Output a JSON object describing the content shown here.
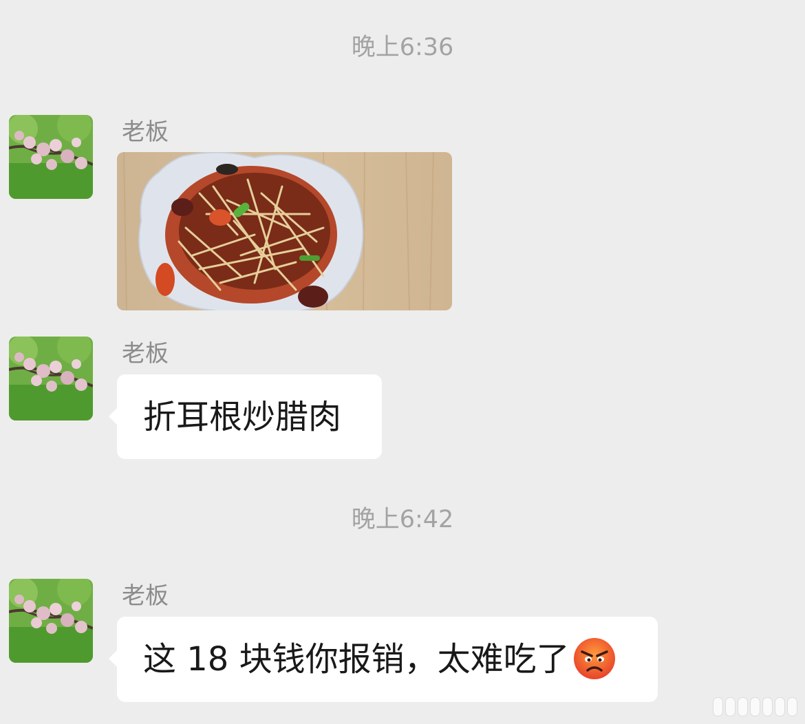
{
  "messages": [
    {
      "time": "晚上6:36",
      "sender": "老板",
      "type": "image",
      "image_alt": "photo"
    },
    {
      "sender": "老板",
      "type": "text",
      "text": "折耳根炒腊肉"
    },
    {
      "time": "晚上6:42",
      "sender": "老板",
      "type": "text",
      "text": "这 18 块钱你报销，太难吃了",
      "emoji": "angry-face-emoji"
    }
  ],
  "colors": {
    "background": "#ededed",
    "bubble": "#ffffff",
    "timestamp": "#a3a3a3",
    "sender_name": "#8c8c8c",
    "text": "#191919"
  }
}
